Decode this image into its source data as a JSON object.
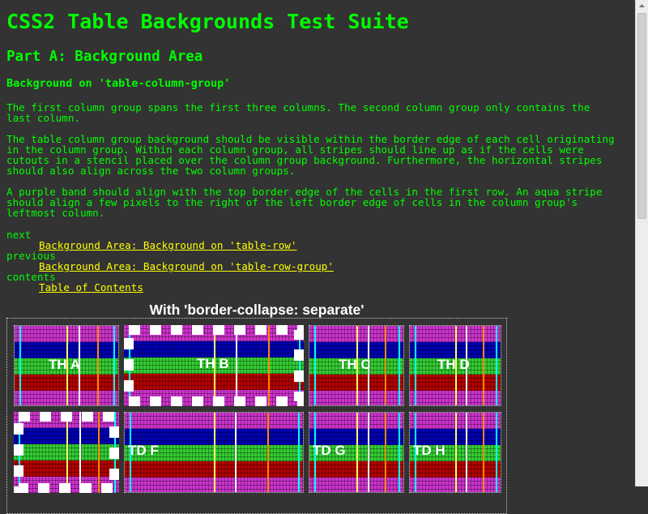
{
  "doc": {
    "title": "CSS2 Table Backgrounds Test Suite",
    "part": "Part A: Background Area",
    "section": "Background on 'table-column-group'",
    "paragraphs": [
      "The first column group spans the first three columns. The second column group only contains the last column.",
      "The table column group background should be visible within the border edge of each cell originating in the column group. Within each column group, all stripes should line up as if the cells were cutouts in a stencil placed over the column group background. Furthermore, the horizontal stripes should also align across the two column groups.",
      "A purple band should align with the top border edge of the cells in the first row. An aqua stripe should align a few pixels to the right of the left border edge of cells in the column group's leftmost column."
    ]
  },
  "nav": {
    "next_label": "next",
    "next_link": "Background Area: Background on 'table-row'",
    "previous_label": "previous",
    "previous_link": "Background Area: Background on 'table-row-group'",
    "contents_label": "contents",
    "contents_link": "Table of Contents"
  },
  "table": {
    "caption": "With 'border-collapse: separate'",
    "cells": {
      "th_a": "TH A",
      "th_b": "TH B",
      "th_c": "TH C",
      "th_d": "TH D",
      "td_f": "TD F",
      "td_g": "TD G",
      "td_h": "TD H"
    }
  },
  "colors": {
    "page_background": "#333333",
    "text": "#00ff00",
    "link": "#ffff00",
    "caption": "#ffffff",
    "stripe_purple": "#cc33cc",
    "stripe_blue": "#0000b4",
    "stripe_green": "#33cc33",
    "stripe_red": "#b40000",
    "stripe_aqua": "#00ffff"
  },
  "scrollbar": {
    "up_arrow_icon": "scroll-up-arrow-icon"
  }
}
